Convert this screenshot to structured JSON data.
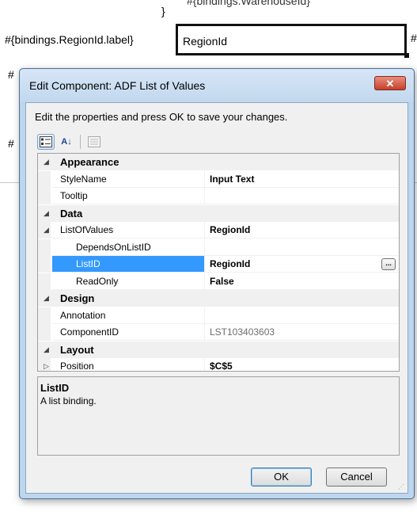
{
  "background": {
    "top_brace": "}",
    "top_binding_fragment": "#{bindings.WarehouseId}",
    "label_text": "#{bindings.RegionId.label}",
    "region_value": "RegionId",
    "hash_glyph": "#"
  },
  "dialog": {
    "title": "Edit Component: ADF List of Values",
    "close_label": "✕",
    "instructions": "Edit the properties and press OK to save your changes.",
    "toolbar": {
      "categorized_icon": "categorized-icon",
      "sort_az_label": "A↓",
      "property_pages_icon": "property-pages-icon"
    },
    "properties": [
      {
        "type": "category",
        "name": "Appearance",
        "expander": "◢"
      },
      {
        "type": "prop",
        "name": "StyleName",
        "value": "Input Text",
        "bold": true
      },
      {
        "type": "prop",
        "name": "Tooltip",
        "value": ""
      },
      {
        "type": "category",
        "name": "Data",
        "expander": "◢"
      },
      {
        "type": "prop",
        "name": "ListOfValues",
        "value": "RegionId",
        "bold": true,
        "expander": "◢"
      },
      {
        "type": "prop",
        "name": "DependsOnListID",
        "value": "",
        "indent": true
      },
      {
        "type": "prop",
        "name": "ListID",
        "value": "RegionId",
        "bold": true,
        "indent": true,
        "selected": true,
        "ellipsis": "..."
      },
      {
        "type": "prop",
        "name": "ReadOnly",
        "value": "False",
        "bold": true,
        "indent": true
      },
      {
        "type": "category",
        "name": "Design",
        "expander": "◢"
      },
      {
        "type": "prop",
        "name": "Annotation",
        "value": ""
      },
      {
        "type": "prop",
        "name": "ComponentID",
        "value": "LST103403603",
        "gray": true
      },
      {
        "type": "category",
        "name": "Layout",
        "expander": "◢"
      },
      {
        "type": "prop",
        "name": "Position",
        "value": "$C$5",
        "bold": true,
        "expander": "▷"
      }
    ],
    "description": {
      "title": "ListID",
      "text": "A list binding."
    },
    "ok_label": "OK",
    "cancel_label": "Cancel"
  }
}
